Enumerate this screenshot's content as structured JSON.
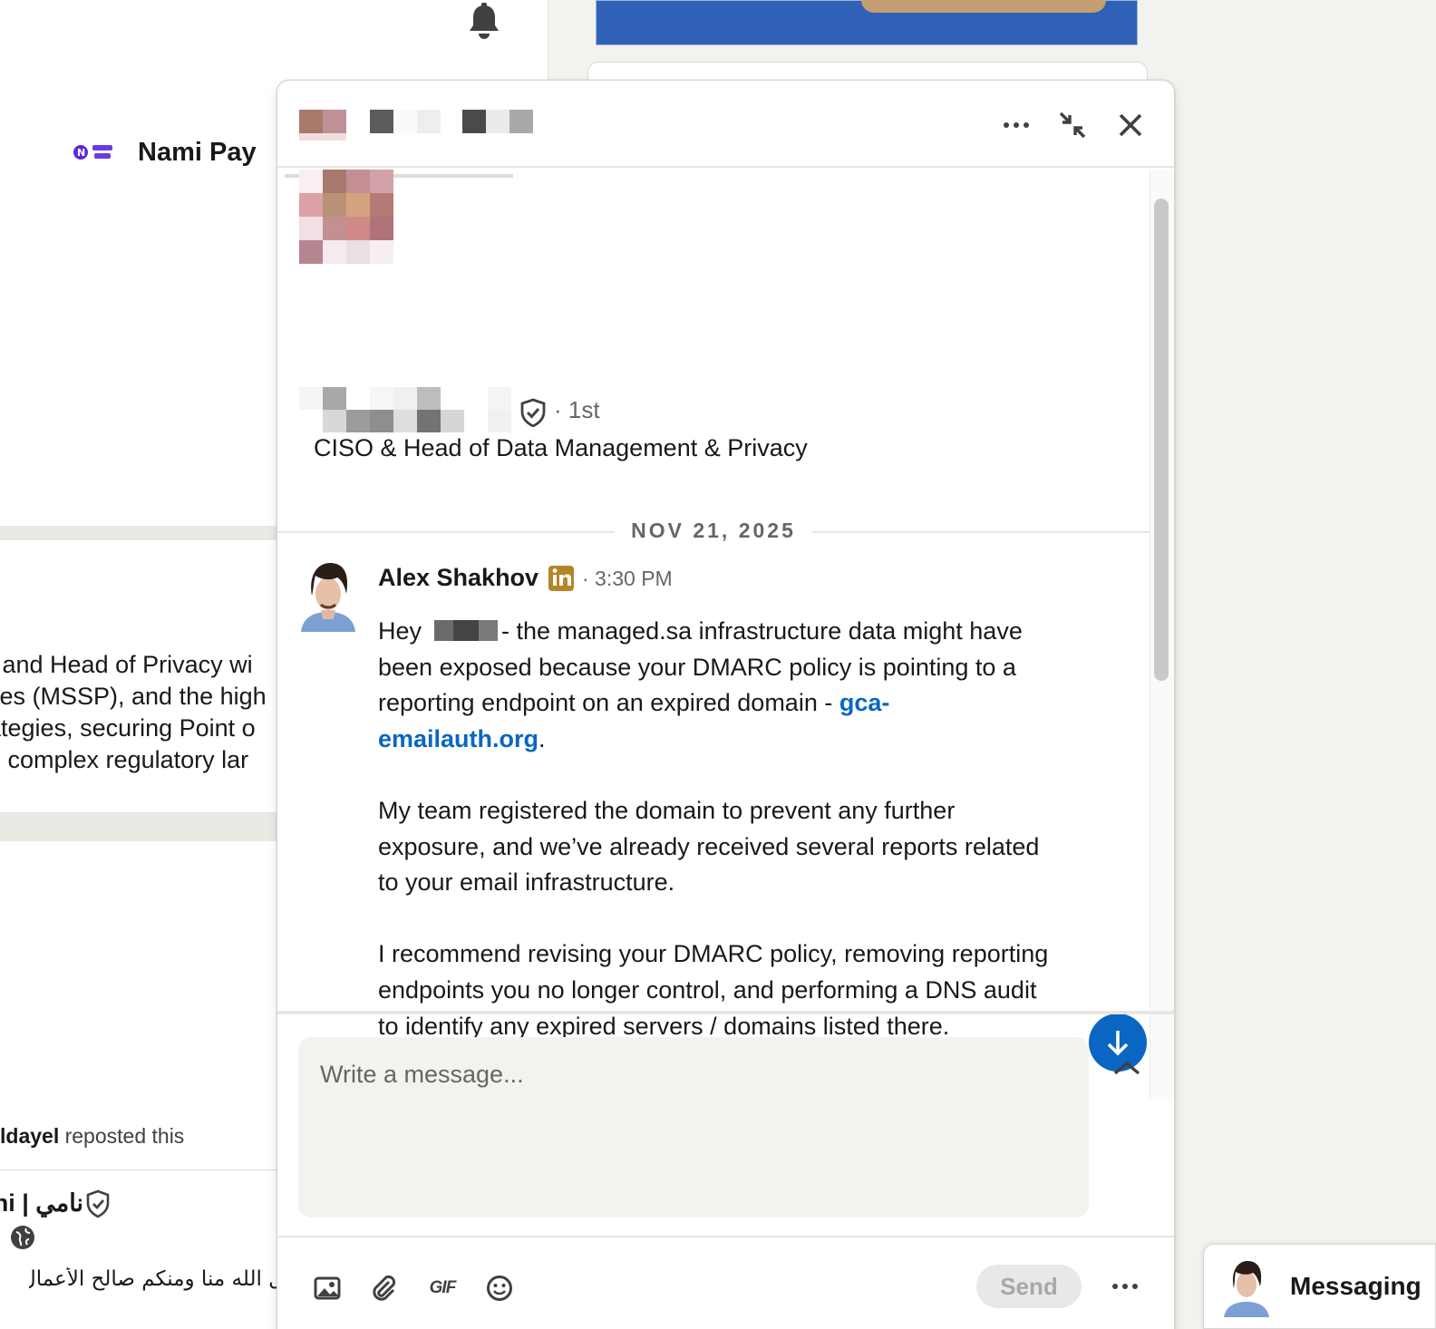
{
  "background": {
    "company_name": "Nami Pay",
    "about_lines": [
      ") and Head of Privacy wi",
      "ces (MSSP), and the high",
      "ategies, securing Point o",
      "g complex regulatory lar"
    ],
    "repost_name": "ldayel",
    "repost_suffix": " reposted this",
    "arabic_name": "نامي | ni",
    "arabic_post": "بل الله منا ومنكم صالح الأعمال"
  },
  "chat": {
    "header_icons": [
      "more-icon",
      "minimize-icon",
      "close-icon"
    ],
    "profile": {
      "degree": "· 1st",
      "headline": "CISO & Head of Data Management & Privacy"
    },
    "date_divider": "NOV 21, 2025",
    "message": {
      "sender": "Alex Shakhov",
      "time": "· 3:30 PM",
      "p1_start": "Hey",
      "p1_mid": "- the managed.sa infrastructure data might have been exposed because your DMARC policy is pointing to a reporting endpoint on an expired domain -",
      "link": "gca-emailauth.org",
      "p1_end": ".",
      "p2": "My team registered the domain to prevent any further exposure, and we’ve already received several reports related to your email infrastructure.",
      "p3": "I recommend revising your DMARC policy, removing reporting endpoints you no longer control, and performing a DNS audit to identify any expired servers / domains listed there."
    },
    "compose": {
      "placeholder": "Write a message...",
      "gif_label": "GIF",
      "send_label": "Send"
    }
  },
  "dock": {
    "title": "Messaging"
  },
  "colors": {
    "accent": "#0a66c2",
    "linkedin_badge": "#b5852a",
    "page_bg": "#f4f2ee"
  }
}
